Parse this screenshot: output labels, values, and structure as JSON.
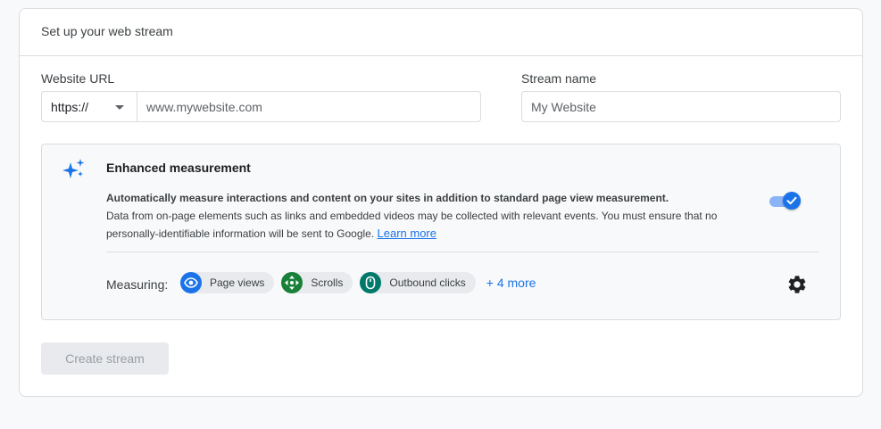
{
  "card": {
    "title": "Set up your web stream"
  },
  "url_field": {
    "label": "Website URL",
    "protocol": "https://",
    "placeholder": "www.mywebsite.com"
  },
  "stream_name": {
    "label": "Stream name",
    "placeholder": "My Website"
  },
  "enhanced": {
    "title": "Enhanced measurement",
    "desc_bold": "Automatically measure interactions and content on your sites in addition to standard page view measurement.",
    "desc": "Data from on-page elements such as links and embedded videos may be collected with relevant events. You must ensure that no personally-identifiable information will be sent to Google.",
    "learn_more": "Learn more",
    "toggle_on": true,
    "measuring_label": "Measuring:",
    "chips": [
      {
        "label": "Page views",
        "icon": "eye-icon",
        "color": "#1a73e8"
      },
      {
        "label": "Scrolls",
        "icon": "scroll-icon",
        "color": "#188038"
      },
      {
        "label": "Outbound clicks",
        "icon": "mouse-icon",
        "color": "#00796b"
      }
    ],
    "more": "+ 4 more"
  },
  "create_button": "Create stream",
  "colors": {
    "accent": "#1a73e8",
    "toggle_track": "#8ab4f8",
    "border": "#dadce0",
    "background": "#f8f9fa"
  }
}
